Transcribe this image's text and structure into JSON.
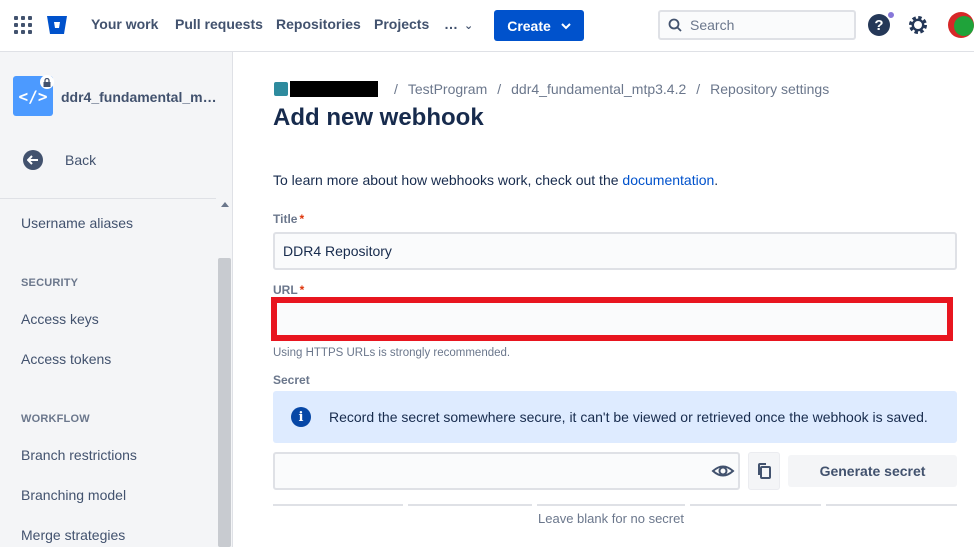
{
  "nav": {
    "links": [
      "Your work",
      "Pull requests",
      "Repositories",
      "Projects",
      "…"
    ],
    "create_label": "Create",
    "search_placeholder": "Search",
    "help_label": "?",
    "accent": "#0052cc"
  },
  "sidebar": {
    "repo_name": "ddr4_fundamental_mt…",
    "repo_icon": "</>",
    "back_label": "Back",
    "items": {
      "username_aliases": "Username aliases",
      "security_heading": "SECURITY",
      "access_keys": "Access keys",
      "access_tokens": "Access tokens",
      "workflow_heading": "WORKFLOW",
      "branch_restrictions": "Branch restrictions",
      "branching_model": "Branching model",
      "merge_strategies": "Merge strategies"
    }
  },
  "breadcrumb": {
    "items": [
      "TestProgram",
      "ddr4_fundamental_mtp3.4.2",
      "Repository settings"
    ],
    "separator": "/"
  },
  "page": {
    "title": "Add new webhook",
    "intro_text": "To learn more about how webhooks work, check out the ",
    "intro_link": "documentation",
    "intro_end": "."
  },
  "form": {
    "title_label": "Title",
    "title_value": "DDR4 Repository",
    "url_label": "URL",
    "url_value": "",
    "url_hint": "Using HTTPS URLs is strongly recommended.",
    "secret_label": "Secret",
    "secret_info": "Record the secret somewhere secure, it can't be viewed or retrieved once the webhook is saved.",
    "secret_value": "",
    "generate_label": "Generate secret",
    "secret_hint": "Leave blank for no secret",
    "required_mark": "*",
    "info_icon": "i"
  },
  "colors": {
    "highlight": "#e8151f",
    "info_bg": "#deebff"
  }
}
